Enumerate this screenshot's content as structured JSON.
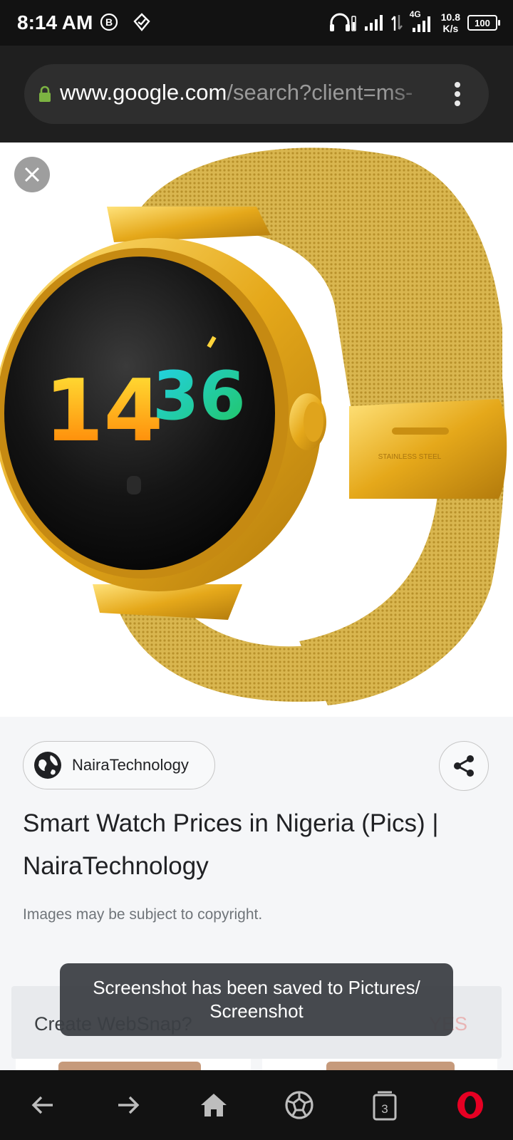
{
  "status_bar": {
    "time": "8:14 AM",
    "network_type": "4G",
    "net_speed_value": "10.8",
    "net_speed_unit": "K/s",
    "battery_level": "100"
  },
  "address_bar": {
    "url_host": "www.google.com",
    "url_path": "/search?client=ms-"
  },
  "image_viewer": {
    "watch_display_hours": "14",
    "watch_display_minutes": "36",
    "clasp_text": "STAINLESS STEEL"
  },
  "result": {
    "source_name": "NairaTechnology",
    "title": "Smart Watch Prices in Nigeria (Pics) | NairaTechnology",
    "copyright_note": "Images may be subject to copyright."
  },
  "websnap": {
    "label": "Create WebSnap?",
    "accept_label": "YES"
  },
  "toast": {
    "line1": "Screenshot has been saved to  Pictures/",
    "line2": "Screenshot"
  },
  "bottom_nav": {
    "tab_count": "3"
  },
  "colors": {
    "accent_red": "#e60023",
    "lock_green": "#7cb342"
  }
}
